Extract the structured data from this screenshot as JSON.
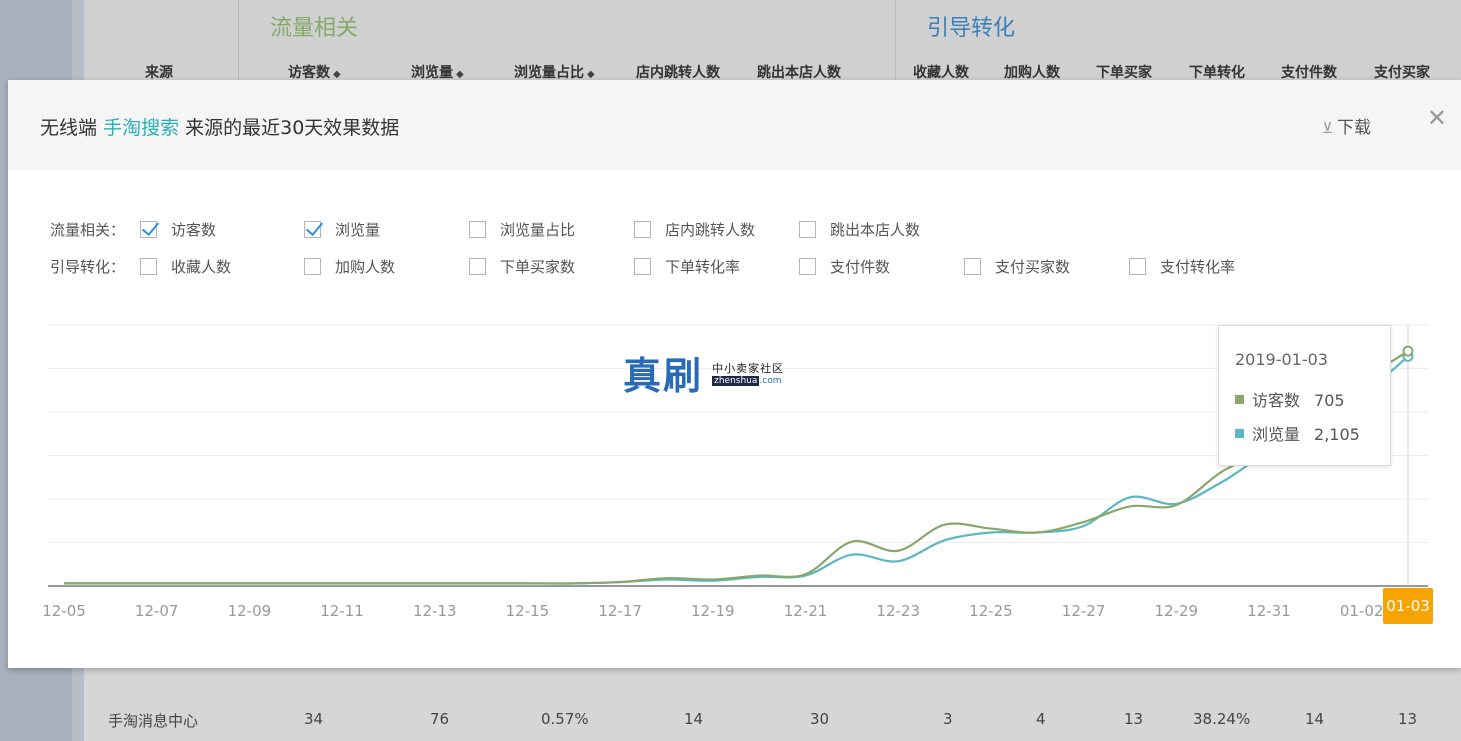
{
  "background": {
    "group_flow": "流量相关",
    "group_conv": "引导转化",
    "headers": {
      "source": "来源",
      "visitors": "访客数",
      "views": "浏览量",
      "view_share": "浏览量占比",
      "jump": "店内跳转人数",
      "exit": "跳出本店人数",
      "fav": "收藏人数",
      "cart": "加购人数",
      "buyers": "下单买家",
      "order_conv": "下单转化",
      "pay_items": "支付件数",
      "pay_buyers": "支付买家"
    },
    "row": {
      "source": "手淘消息中心",
      "visitors": "34",
      "views": "76",
      "view_share": "0.57%",
      "jump": "14",
      "exit": "30",
      "fav": "3",
      "cart": "4",
      "buyers": "13",
      "order_conv": "38.24%",
      "pay_items": "14",
      "pay_buyers": "13"
    }
  },
  "modal": {
    "title_prefix": "无线端",
    "title_highlight": "手淘搜索",
    "title_suffix": "来源的最近30天效果数据",
    "download_label": "下载",
    "download_icon": "download-arrow-icon",
    "close_icon": "close-x-icon",
    "filters": {
      "flow_label": "流量相关：",
      "conv_label": "引导转化：",
      "flow_options": [
        {
          "label": "访客数",
          "checked": true
        },
        {
          "label": "浏览量",
          "checked": true
        },
        {
          "label": "浏览量占比",
          "checked": false
        },
        {
          "label": "店内跳转人数",
          "checked": false
        },
        {
          "label": "跳出本店人数",
          "checked": false
        }
      ],
      "conv_options": [
        {
          "label": "收藏人数",
          "checked": false
        },
        {
          "label": "加购人数",
          "checked": false
        },
        {
          "label": "下单买家数",
          "checked": false
        },
        {
          "label": "下单转化率",
          "checked": false
        },
        {
          "label": "支付件数",
          "checked": false
        },
        {
          "label": "支付买家数",
          "checked": false
        },
        {
          "label": "支付转化率",
          "checked": false
        }
      ]
    },
    "tooltip": {
      "date": "2019-01-03",
      "series": [
        {
          "name": "访客数",
          "value": "705",
          "color": "#8aa66a"
        },
        {
          "name": "浏览量",
          "value": "2,105",
          "color": "#5cb8c0"
        }
      ]
    },
    "watermark": {
      "big": "真刷",
      "cn": "中小卖家社区",
      "en_dark": "zhenshua",
      "en_com": ".com"
    }
  },
  "chart_data": {
    "type": "line",
    "x_tick_labels": [
      "12-05",
      "12-07",
      "12-09",
      "12-11",
      "12-13",
      "12-15",
      "12-17",
      "12-19",
      "12-21",
      "12-23",
      "12-25",
      "12-27",
      "12-29",
      "12-31",
      "01-02"
    ],
    "highlight_label": "01-03",
    "x": [
      "12-05",
      "12-06",
      "12-07",
      "12-08",
      "12-09",
      "12-10",
      "12-11",
      "12-12",
      "12-13",
      "12-14",
      "12-15",
      "12-16",
      "12-17",
      "12-18",
      "12-19",
      "12-20",
      "12-21",
      "12-22",
      "12-23",
      "12-24",
      "12-25",
      "12-26",
      "12-27",
      "12-28",
      "12-29",
      "12-30",
      "12-31",
      "01-01",
      "01-02",
      "01-03"
    ],
    "series_normalized": [
      {
        "name": "访客数",
        "color": "#8aa66a",
        "values": [
          0.01,
          0.01,
          0.01,
          0.01,
          0.01,
          0.01,
          0.01,
          0.01,
          0.01,
          0.01,
          0.01,
          0.01,
          0.015,
          0.03,
          0.025,
          0.04,
          0.045,
          0.17,
          0.135,
          0.235,
          0.22,
          0.205,
          0.245,
          0.305,
          0.31,
          0.44,
          0.52,
          0.6,
          0.78,
          0.9
        ]
      },
      {
        "name": "浏览量",
        "color": "#5cb8c0",
        "values": [
          0.01,
          0.01,
          0.01,
          0.01,
          0.01,
          0.01,
          0.01,
          0.01,
          0.01,
          0.01,
          0.01,
          0.01,
          0.015,
          0.025,
          0.02,
          0.035,
          0.04,
          0.12,
          0.095,
          0.175,
          0.205,
          0.205,
          0.23,
          0.34,
          0.315,
          0.4,
          0.51,
          0.55,
          0.72,
          0.88
        ]
      }
    ],
    "grid": true,
    "legend": "tooltip"
  }
}
